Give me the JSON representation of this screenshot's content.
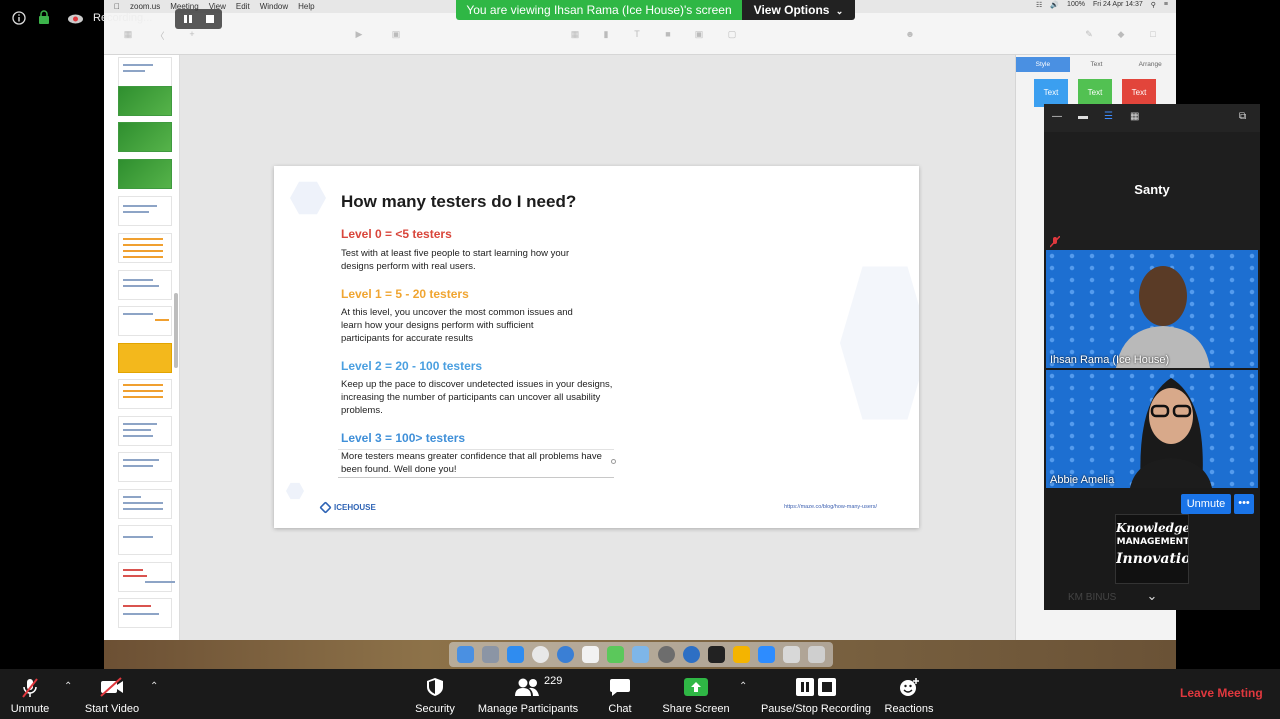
{
  "topbar": {
    "recording_label": "Recording...",
    "sharing_banner": "You are viewing Ihsan Rama (Ice House)'s screen",
    "view_options_label": "View Options"
  },
  "mac_menu": {
    "items": [
      "zoom.us",
      "Meeting",
      "View",
      "Edit",
      "Window",
      "Help"
    ],
    "battery": "100%",
    "datetime": "Fri 24 Apr 14:37"
  },
  "slide": {
    "title": "How many testers do I need?",
    "levels": [
      {
        "heading": "Level 0 = <5 testers",
        "color": "#d9463b",
        "text": "Test with at least five people to start learning how your designs perform with real users."
      },
      {
        "heading": "Level 1 = 5 - 20 testers",
        "color": "#f0a531",
        "text": "At this level, you uncover the most common issues and learn how your designs perform with sufficient participants for accurate results"
      },
      {
        "heading": "Level 2 = 20 - 100 testers",
        "color": "#4a9fe0",
        "text": "Keep up the pace to discover undetected issues in your designs, increasing the number of participants can uncover all usability problems."
      },
      {
        "heading": "Level 3 = 100> testers",
        "color": "#3f8fd8",
        "text": "More testers means greater confidence that all problems have been found. Well done you!"
      }
    ],
    "logo_text": "ICEHOUSE",
    "url": "https://maze.co/blog/how-many-users/"
  },
  "inspector": {
    "tabs": [
      "Style",
      "Text",
      "Arrange"
    ],
    "active_tab": "Style",
    "swatches": [
      {
        "label": "Text",
        "color": "#3b9ff0"
      },
      {
        "label": "Text",
        "color": "#52c152"
      },
      {
        "label": "Text",
        "color": "#e2453b"
      }
    ]
  },
  "gallery": {
    "participants": [
      {
        "name": "Santy",
        "video": false,
        "muted": true
      },
      {
        "name": "Ihsan Rama (Ice House)",
        "video": true
      },
      {
        "name": "Abbie Amelia",
        "video": true
      }
    ],
    "unmute_label": "Unmute",
    "more_label": "•••",
    "logo_lines": [
      "Knowledge",
      "MANAGEMENT",
      "Innovation"
    ],
    "self_name": "KM BINUS"
  },
  "toolbar": {
    "unmute_label": "Unmute",
    "start_video_label": "Start Video",
    "security_label": "Security",
    "participants_label": "Manage Participants",
    "participants_count": "229",
    "chat_label": "Chat",
    "share_label": "Share Screen",
    "recording_label": "Pause/Stop Recording",
    "reactions_label": "Reactions",
    "leave_label": "Leave Meeting"
  }
}
